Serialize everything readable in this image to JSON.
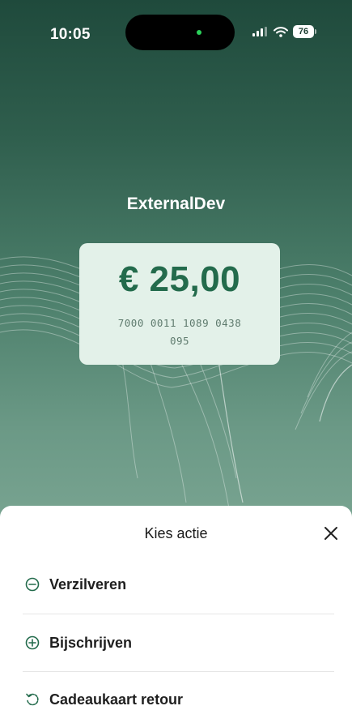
{
  "status_bar": {
    "time": "10:05",
    "battery": "76"
  },
  "card": {
    "merchant": "ExternalDev",
    "amount": "€ 25,00",
    "number_line1": "7000 0011 1089 0438",
    "number_line2": "095"
  },
  "sheet": {
    "title": "Kies actie",
    "actions": [
      {
        "label": "Verzilveren",
        "icon": "minus-circle-icon"
      },
      {
        "label": "Bijschrijven",
        "icon": "plus-circle-icon"
      },
      {
        "label": "Cadeaukaart retour",
        "icon": "undo-icon"
      }
    ]
  },
  "colors": {
    "accent": "#236b4c",
    "card_bg": "#e3f1e9",
    "hero_top": "#1f4a3c",
    "hero_bottom": "#7aa592"
  }
}
